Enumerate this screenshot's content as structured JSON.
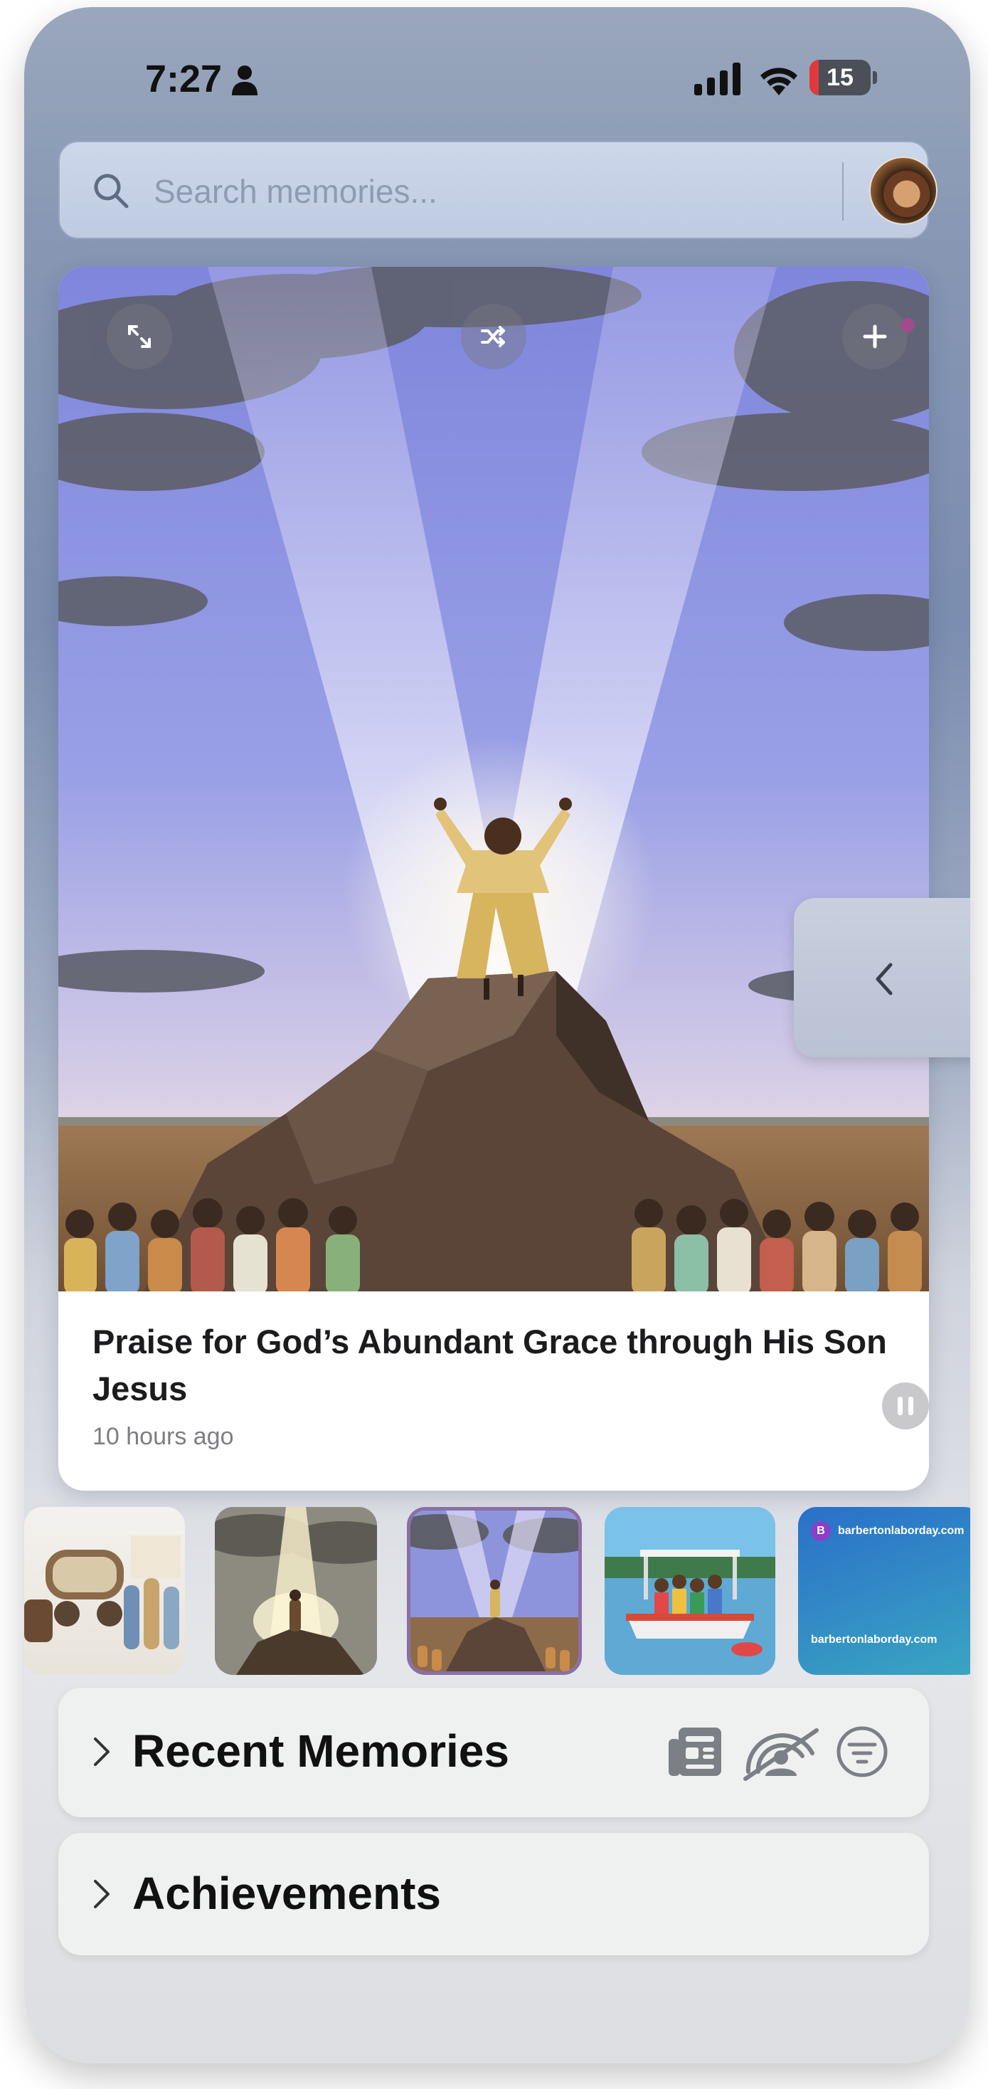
{
  "status_bar": {
    "time": "7:27",
    "battery_level": "15",
    "battery_fraction": 0.15,
    "icons": [
      "person-icon",
      "cellular-signal-icon",
      "wifi-icon",
      "battery-icon"
    ]
  },
  "search": {
    "placeholder": "Search memories..."
  },
  "featured_memory": {
    "title": "Praise for God’s Abundant Grace through His Son Jesus",
    "time_ago": "10 hours ago",
    "controls": [
      "expand-icon",
      "shuffle-icon",
      "plus-icon",
      "pause-icon"
    ]
  },
  "thumbnails": [
    {
      "name": "caravan-procession"
    },
    {
      "name": "figure-in-light"
    },
    {
      "name": "praise-on-rock",
      "selected": true
    },
    {
      "name": "boat-friends"
    },
    {
      "name": "website-card",
      "badge": "B",
      "site_top": "barbertonlaborday.com",
      "site_bottom": "barbertonlaborday.com"
    }
  ],
  "sections": {
    "recent_memories": "Recent Memories",
    "achievements": "Achievements"
  },
  "colors": {
    "accent_selected": "#8a6fa5",
    "battery_low": "#e0383b"
  }
}
